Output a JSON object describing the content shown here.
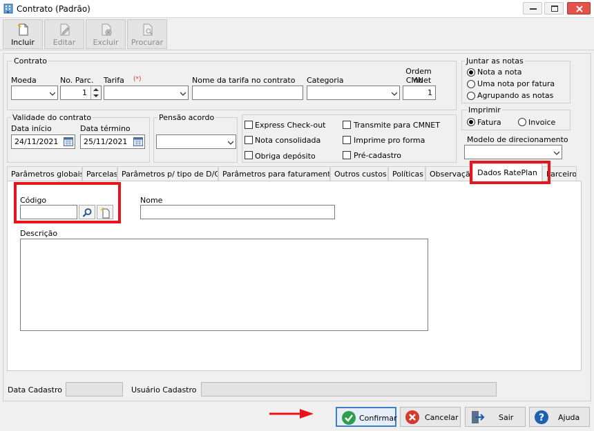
{
  "window": {
    "title": "Contrato (Padrão)"
  },
  "toolbar": {
    "incluir": "Incluir",
    "editar": "Editar",
    "excluir": "Excluir",
    "procurar": "Procurar"
  },
  "contrato": {
    "group_label": "Contrato",
    "moeda_label": "Moeda",
    "moeda_value": "",
    "parc_label": "No. Parc.",
    "parc_value": "1",
    "tarifa_label": "Tarifa",
    "tarifa_required": "(*)",
    "tarifa_value": "",
    "nome_tarifa_label": "Nome da tarifa no contrato",
    "nome_tarifa_value": "",
    "categoria_label": "Categoria",
    "categoria_value": "",
    "ordem_label_1": "Ordem no",
    "ordem_label_2": "CMNet",
    "ordem_value": "1"
  },
  "juntar": {
    "label": "Juntar as notas",
    "options": [
      "Nota a nota",
      "Uma nota por fatura",
      "Agrupando as notas"
    ],
    "selected": 0
  },
  "validade": {
    "label": "Validade do contrato",
    "inicio_label": "Data início",
    "inicio_value": "24/11/2021",
    "termino_label": "Data término",
    "termino_value": "25/11/2021"
  },
  "pensao": {
    "label": "Pensão acordo",
    "value": ""
  },
  "checks": {
    "express": "Express Check-out",
    "consolidada": "Nota consolidada",
    "deposito": "Obriga depósito",
    "transmite": "Transmite para CMNET",
    "imprime": "Imprime pro forma",
    "precadastro": "Pré-cadastro"
  },
  "imprimir": {
    "label": "Imprimir",
    "options": [
      "Fatura",
      "Invoice"
    ],
    "selected": 0
  },
  "modelo": {
    "label": "Modelo de direcionamento",
    "value": ""
  },
  "tabs": [
    "Parâmetros globais",
    "Parcelas",
    "Parâmetros p/ tipo de D/C",
    "Parâmetros para faturamento",
    "Outros custos",
    "Políticas",
    "Observação",
    "Dados RatePlan",
    "Parceiros"
  ],
  "active_tab": 7,
  "rateplan": {
    "codigo_label": "Código",
    "codigo_value": "",
    "nome_label": "Nome",
    "nome_value": "",
    "descricao_label": "Descrição",
    "descricao_value": ""
  },
  "footer": {
    "data_cadastro_label": "Data Cadastro",
    "data_cadastro_value": "",
    "usuario_label": "Usuário Cadastro",
    "usuario_value": ""
  },
  "buttons": {
    "confirmar": "Confirmar",
    "cancelar": "Cancelar",
    "sair": "Sair",
    "ajuda": "Ajuda"
  },
  "colors": {
    "highlight": "#e8141b",
    "confirm_green": "#2f9e4a",
    "cancel_red": "#d43a2f",
    "help_blue": "#1d5fb0"
  }
}
